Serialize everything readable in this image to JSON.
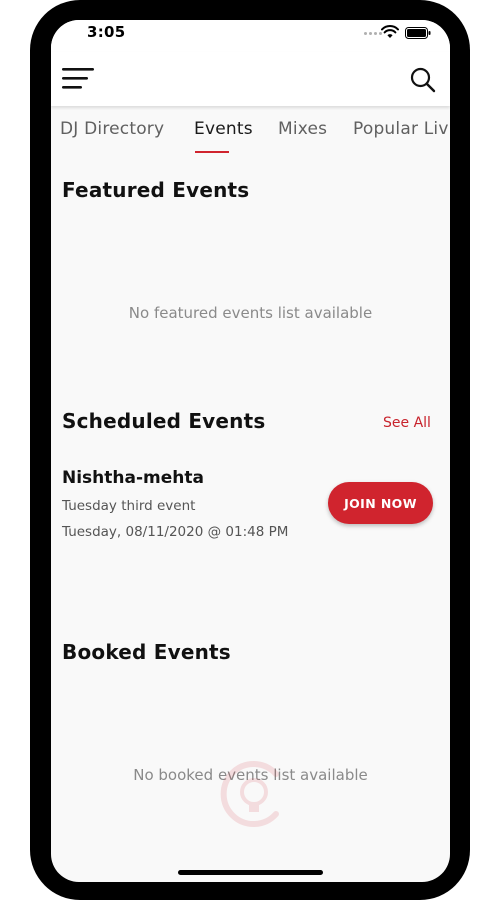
{
  "status_bar": {
    "time": "3:05",
    "icons": [
      "wifi-icon",
      "battery-icon"
    ]
  },
  "header": {
    "menu_icon": "hamburger-menu-icon",
    "search_icon": "search-icon"
  },
  "tabs": [
    {
      "label": "DJ Directory",
      "active": false
    },
    {
      "label": "Events",
      "active": true
    },
    {
      "label": "Mixes",
      "active": false
    },
    {
      "label": "Popular Liv",
      "active": false
    }
  ],
  "featured": {
    "title": "Featured Events",
    "empty_message": "No featured events list available"
  },
  "scheduled": {
    "title": "Scheduled Events",
    "see_all_label": "See All",
    "events": [
      {
        "name": "Nishtha-mehta",
        "description": "Tuesday third event",
        "datetime": "Tuesday, 08/11/2020 @ 01:48 PM",
        "button_label": "JOIN NOW"
      }
    ]
  },
  "booked": {
    "title": "Booked Events",
    "empty_message": "No booked events list available"
  },
  "colors": {
    "accent": "#d0242e",
    "background": "#f9f9f9",
    "text_primary": "#111111",
    "text_muted": "#8a8a8a"
  }
}
